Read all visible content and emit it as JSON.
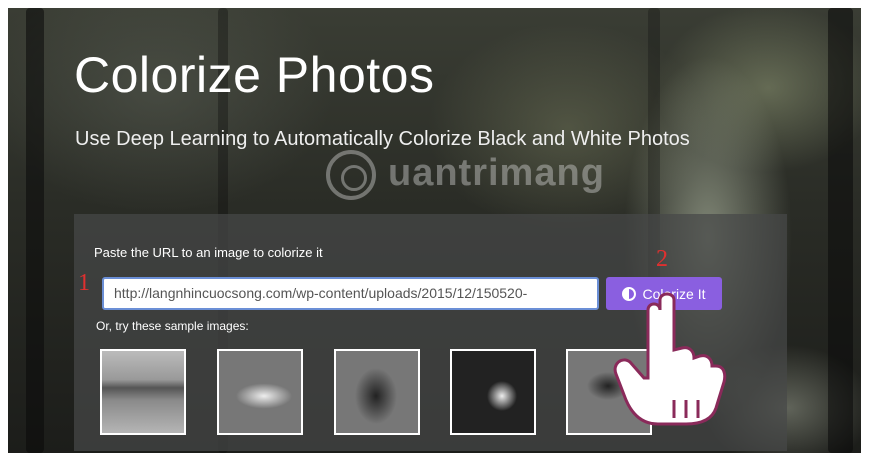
{
  "hero": {
    "title": "Colorize Photos",
    "subtitle": "Use Deep Learning to Automatically Colorize Black and White Photos"
  },
  "watermark": {
    "text": "uantrimang"
  },
  "form": {
    "label": "Paste the URL to an image to colorize it",
    "url_value": "http://langnhincuocsong.com/wp-content/uploads/2015/12/150520-",
    "button_label": "Colorize It",
    "button_icon": "half-circle-icon",
    "button_color": "#8a5fe0",
    "samples_label": "Or, try these sample images:"
  },
  "samples": [
    {
      "name": "sample-image-1"
    },
    {
      "name": "sample-image-2"
    },
    {
      "name": "sample-image-3"
    },
    {
      "name": "sample-image-4"
    },
    {
      "name": "sample-image-5"
    }
  ],
  "annotations": {
    "step1": "1",
    "step2": "2",
    "color": "#e0302f"
  }
}
